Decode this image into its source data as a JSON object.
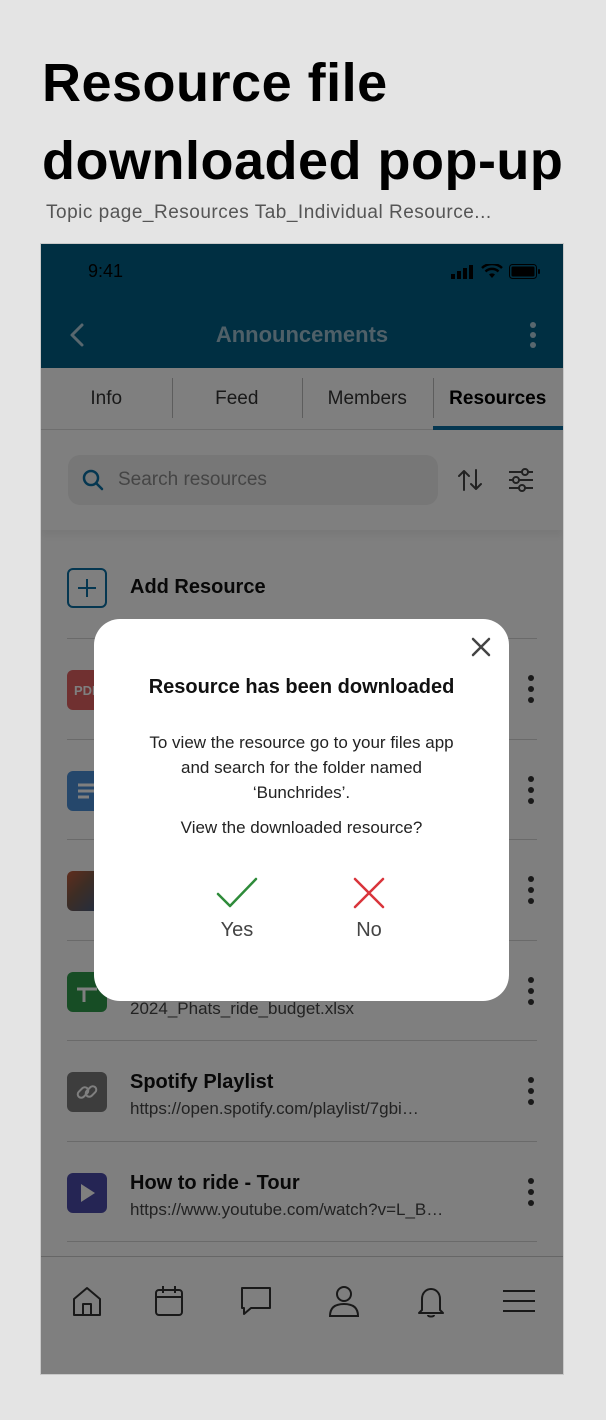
{
  "page": {
    "title": "Resource file downloaded pop-up",
    "subtitle": "Topic page_Resources Tab_Individual Resource..."
  },
  "status_bar": {
    "time": "9:41"
  },
  "header": {
    "title": "Announcements"
  },
  "tabs": [
    {
      "label": "Info",
      "active": false
    },
    {
      "label": "Feed",
      "active": false
    },
    {
      "label": "Members",
      "active": false
    },
    {
      "label": "Resources",
      "active": true
    }
  ],
  "search": {
    "placeholder": "Search resources"
  },
  "add_resource": {
    "label": "Add Resource"
  },
  "resources": [
    {
      "title": "",
      "subtitle": "",
      "icon": "pdf-icon",
      "color": "#e06060"
    },
    {
      "title": "",
      "subtitle": "",
      "icon": "document-icon",
      "color": "#4a8fd6"
    },
    {
      "title": "",
      "subtitle": "",
      "icon": "image-thumbnail",
      "color": "#7a5a4a"
    },
    {
      "title": "",
      "subtitle": "2024_Phats_ride_budget.xlsx",
      "icon": "spreadsheet-icon",
      "color": "#2f9a4a"
    },
    {
      "title": "Spotify Playlist",
      "subtitle": "https://open.spotify.com/playlist/7gbi…",
      "icon": "link-icon",
      "color": "#7a7a7a"
    },
    {
      "title": "How to ride - Tour",
      "subtitle": "https://www.youtube.com/watch?v=L_B…",
      "icon": "video-icon",
      "color": "#4b4aa8"
    }
  ],
  "dialog": {
    "heading": "Resource has been downloaded",
    "body": "To view the resource go to your files app and search for the folder named ‘Bunchrides’.",
    "question": "View the downloaded resource?",
    "yes_label": "Yes",
    "no_label": "No"
  },
  "colors": {
    "primary": "#005e85",
    "accent": "#0a6fa3",
    "yes": "#2e8b3a",
    "no": "#d9343b"
  }
}
